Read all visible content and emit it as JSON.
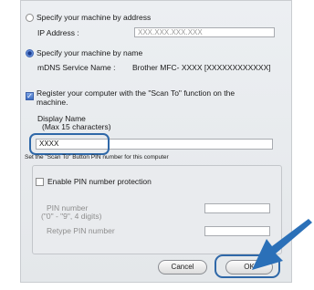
{
  "address_section": {
    "radio_label": "Specify your machine by address",
    "ip_label": "IP Address :",
    "ip_placeholder": "XXX.XXX.XXX.XXX"
  },
  "name_section": {
    "radio_label": "Specify your machine by name",
    "mdns_label": "mDNS Service Name :",
    "mdns_value": "Brother MFC- XXXX   [XXXXXXXXXXXX]"
  },
  "scan_to": {
    "checkbox_label_line1": "Register your computer with the \"Scan To\" function on the",
    "checkbox_label_line2": "machine.",
    "display_name_label": "Display Name",
    "display_name_hint": "(Max 15 characters)",
    "display_name_value": "XXXX"
  },
  "pin": {
    "section_label": "Set the \"Scan To\" Button PIN number for this computer",
    "enable_label": "Enable PIN number protection",
    "pin_label_line1": "PIN number",
    "pin_label_line2": "(\"0\" - \"9\",  4 digits)",
    "retype_label": "Retype PIN number"
  },
  "buttons": {
    "cancel": "Cancel",
    "ok": "OK"
  },
  "colors": {
    "highlight": "#2f68a8",
    "arrow": "#2b70b8"
  }
}
